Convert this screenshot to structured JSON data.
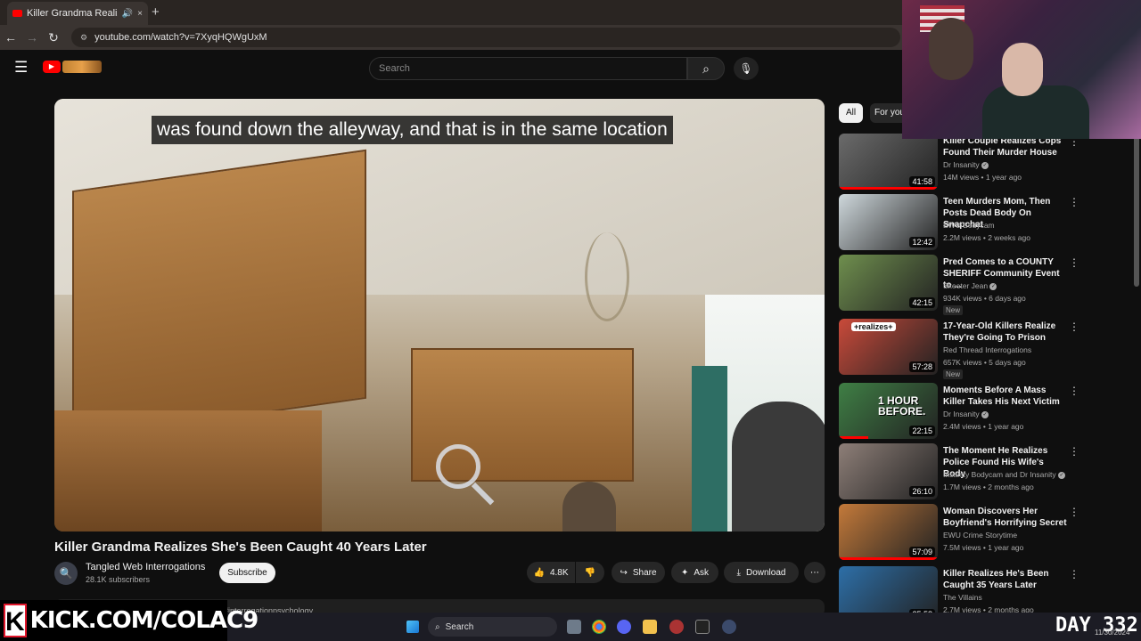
{
  "browser": {
    "tab_title": "Killer Grandma Realizes She",
    "url": "youtube.com/watch?v=7XyqHQWgUxM",
    "new_tab": "+",
    "close_tab": "×"
  },
  "header": {
    "search_placeholder": "Search"
  },
  "video": {
    "caption": "was found down the alleyway, and that is in the same location",
    "title": "Killer Grandma Realizes She's Been Caught 40 Years Later"
  },
  "channel": {
    "name": "Tangled Web Interrogations",
    "subscribers": "28.1K subscribers",
    "subscribe_label": "Subscribe"
  },
  "actions": {
    "likes": "4.8K",
    "share": "Share",
    "ask": "Ask",
    "download": "Download"
  },
  "description_snippet": "#interrogationpsychology",
  "sidebar": {
    "chips": [
      "All",
      "For you"
    ],
    "recommendations": [
      {
        "title": "Killer Couple Realizes Cops Found Their Murder House",
        "channel": "Dr Insanity",
        "verified": true,
        "meta": "14M views • 1 year ago",
        "duration": "41:58",
        "is_new": false,
        "thumb_color": "#6b6b6b",
        "watched": 1.0
      },
      {
        "title": "Teen Murders Mom, Then Posts Dead Body On Snapchat",
        "channel": "EWU Bodycam",
        "verified": false,
        "meta": "2.2M views • 2 weeks ago",
        "duration": "12:42",
        "is_new": false,
        "thumb_color": "#cfd8dc",
        "watched": 0
      },
      {
        "title": "Pred Comes to a COUNTY SHERIFF Community Event to ...",
        "channel": "Skeeter Jean",
        "verified": true,
        "meta": "934K views • 6 days ago",
        "duration": "42:15",
        "is_new": true,
        "thumb_color": "#6f8f4e",
        "watched": 0
      },
      {
        "title": "17-Year-Old Killers Realize They're Going To Prison",
        "channel": "Red Thread Interrogations",
        "verified": false,
        "meta": "657K views • 5 days ago",
        "duration": "57:28",
        "is_new": true,
        "thumb_color": "#c94a3a",
        "watched": 0
      },
      {
        "title": "Moments Before A Mass Killer Takes His Next Victim",
        "channel": "Dr Insanity",
        "verified": true,
        "meta": "2.4M views • 1 year ago",
        "duration": "22:15",
        "is_new": false,
        "thumb_color": "#3f7f45",
        "watched": 0.3
      },
      {
        "title": "The Moment He Realizes Police Found His Wife's Body",
        "channel": "Insanity Bodycam and Dr Insanity",
        "verified": true,
        "meta": "1.7M views • 2 months ago",
        "duration": "26:10",
        "is_new": false,
        "thumb_color": "#8e7f78",
        "watched": 0
      },
      {
        "title": "Woman Discovers Her Boyfriend's Horrifying Secret",
        "channel": "EWU Crime Storytime",
        "verified": false,
        "meta": "7.5M views • 1 year ago",
        "duration": "57:09",
        "is_new": false,
        "thumb_color": "#c47a3a",
        "watched": 1.0
      },
      {
        "title": "Killer Realizes He's Been Caught 35 Years Later",
        "channel": "The Villains",
        "verified": false,
        "meta": "2.7M views • 2 months ago",
        "duration": "25:58",
        "is_new": false,
        "thumb_color": "#2d6fa8",
        "watched": 0
      }
    ]
  },
  "thumbnail_overlays": {
    "rec_3": "+realizes+",
    "rec_4": "1 HOUR BEFORE."
  },
  "taskbar": {
    "search_label": "Search"
  },
  "overlay": {
    "kick_logo": "K",
    "kick_url": "KICK.COM/COLAC9",
    "day_counter": "DAY  332",
    "date": "11/30/2024"
  },
  "colors": {
    "accent": "#ff0000",
    "background": "#0f0f0f",
    "kick_border": "#e0162b"
  }
}
